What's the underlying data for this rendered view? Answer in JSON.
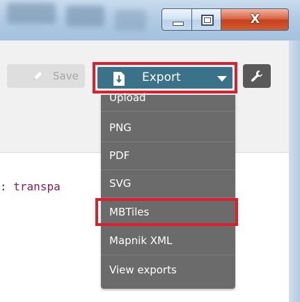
{
  "window": {
    "minimize_label": "—",
    "maximize_label": "▢",
    "close_label": "X"
  },
  "toolbar": {
    "save_label": "Save",
    "export_label": "Export",
    "save_icon": "pencil-icon",
    "export_icon": "download-icon",
    "settings_icon": "wrench-icon"
  },
  "editor": {
    "code_prefix": ":",
    "code_value": "transpa"
  },
  "export_menu": {
    "items": [
      {
        "label": "Upload"
      },
      {
        "label": "PNG"
      },
      {
        "label": "PDF"
      },
      {
        "label": "SVG"
      },
      {
        "label": "MBTiles"
      },
      {
        "label": "Mapnik XML"
      },
      {
        "label": "View exports"
      }
    ],
    "highlighted": "MBTiles"
  },
  "colors": {
    "export_button": "#3a7389",
    "highlight_border": "#d9202f",
    "menu_background": "#6b6b6b"
  }
}
